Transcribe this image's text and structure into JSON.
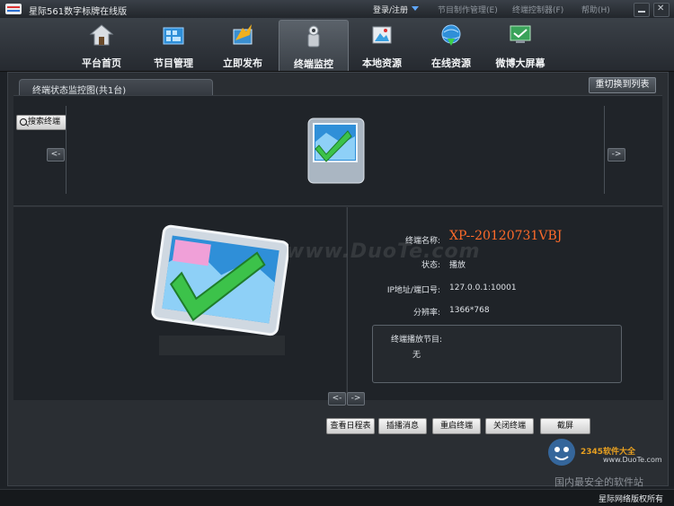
{
  "titlebar": {
    "app_title": "星际561数字标牌在线版",
    "login_label": "登录/注册",
    "links": [
      "节目制作管理(E)",
      "终端控制器(F)",
      "帮助(H)"
    ]
  },
  "nav": {
    "items": [
      {
        "label": "平台首页",
        "icon": "home-icon"
      },
      {
        "label": "节目管理",
        "icon": "program-icon"
      },
      {
        "label": "立即发布",
        "icon": "publish-icon"
      },
      {
        "label": "终端监控",
        "icon": "monitor-icon"
      },
      {
        "label": "本地资源",
        "icon": "local-resource-icon"
      },
      {
        "label": "在线资源",
        "icon": "online-resource-icon"
      },
      {
        "label": "微博大屏幕",
        "icon": "weibo-screen-icon"
      }
    ],
    "active_index": 3
  },
  "tab_title": "终端状态监控图(共1台)",
  "switch_label": "重切换到列表",
  "search_label": "搜索终端",
  "arrows": {
    "prev": "<-",
    "next": "->",
    "left": "<-",
    "right": "->"
  },
  "terminal": {
    "name_label": "终端名称:",
    "name_value": "XP--20120731VBJ",
    "status_label": "状态:",
    "status_value": "播放",
    "ip_label": "IP地址/端口号:",
    "ip_value": "127.0.0.1:10001",
    "resolution_label": "分辨率:",
    "resolution_value": "1366*768",
    "program_label": "终端播放节目:",
    "program_value": "无"
  },
  "actions": {
    "schedule": "查看日程表",
    "message": "插播消息",
    "restart": "重启终端",
    "shutdown": "关闭终端",
    "screenshot": "截屏"
  },
  "watermarks": {
    "duote": "www.DuoTe.com",
    "site_brand": "2345软件大全",
    "site_url": "www.DuoTe.com",
    "site_tagline": "国内最安全的软件站"
  },
  "footer": {
    "copyright": "星际网络版权所有"
  }
}
